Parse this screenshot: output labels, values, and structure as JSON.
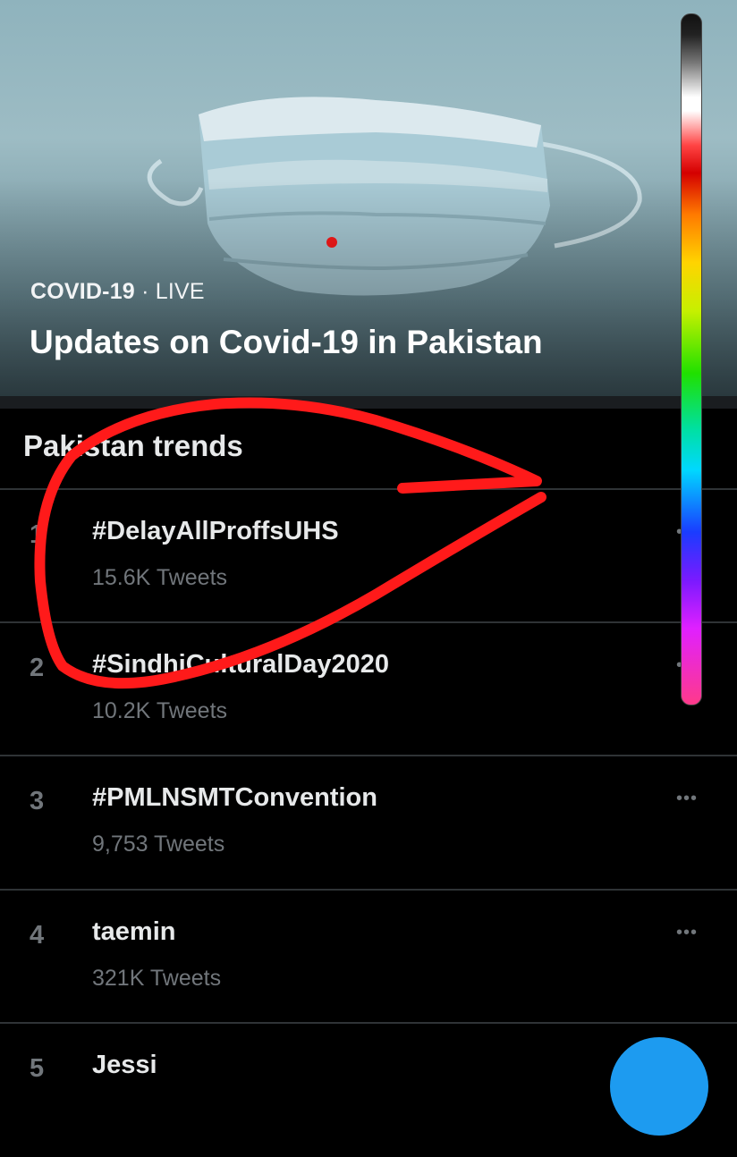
{
  "hero": {
    "category": "COVID-19",
    "separator": " · ",
    "status": "LIVE",
    "title": "Updates on Covid-19 in Pakistan"
  },
  "trends": {
    "title": "Pakistan trends",
    "more_icon": "more-horizontal-icon",
    "items": [
      {
        "rank": "1",
        "name": "#DelayAllProffsUHS",
        "count": "15.6K Tweets"
      },
      {
        "rank": "2",
        "name": "#SindhiCulturalDay2020",
        "count": "10.2K Tweets"
      },
      {
        "rank": "3",
        "name": "#PMLNSMTConvention",
        "count": "9,753 Tweets"
      },
      {
        "rank": "4",
        "name": "taemin",
        "count": "321K Tweets"
      },
      {
        "rank": "5",
        "name": "Jessi",
        "count": ""
      }
    ]
  },
  "colors": {
    "background": "#000000",
    "accent": "#1d9bf0",
    "annotation": "#ff1a1a",
    "muted_text": "#71767b"
  },
  "fab_icon": "compose-icon"
}
